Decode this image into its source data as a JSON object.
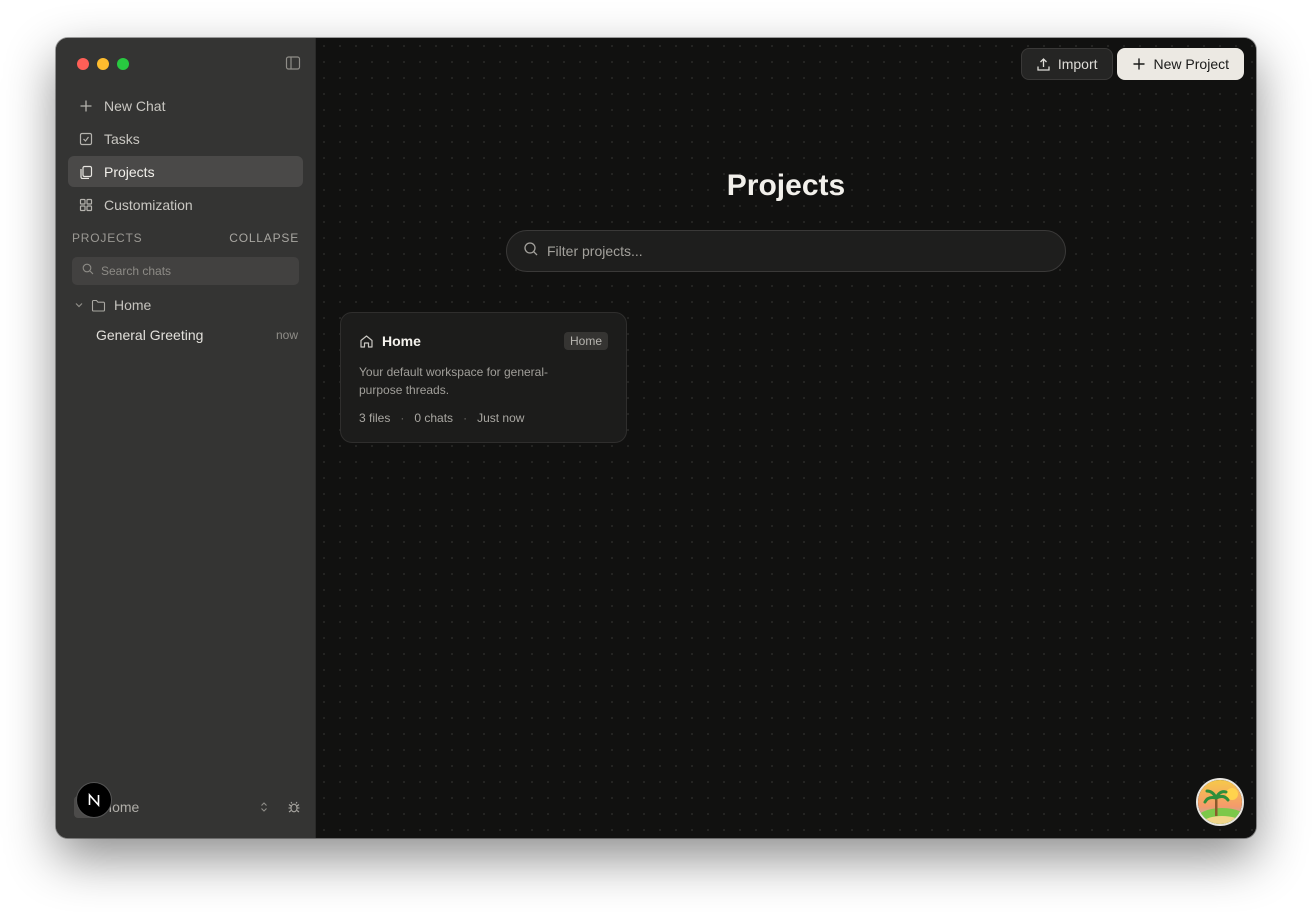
{
  "sidebar": {
    "nav": [
      {
        "label": "New Chat",
        "icon": "plus-icon"
      },
      {
        "label": "Tasks",
        "icon": "checkbox-icon"
      },
      {
        "label": "Projects",
        "icon": "files-icon",
        "active": true
      },
      {
        "label": "Customization",
        "icon": "grid-icon"
      }
    ],
    "section_label": "PROJECTS",
    "collapse_label": "COLLAPSE",
    "search_placeholder": "Search chats",
    "folder": {
      "name": "Home"
    },
    "chats": [
      {
        "title": "General Greeting",
        "time": "now"
      }
    ],
    "workspace_name": "Home"
  },
  "header": {
    "import_label": "Import",
    "new_project_label": "New Project"
  },
  "main": {
    "title": "Projects",
    "filter_placeholder": "Filter projects...",
    "projects": [
      {
        "name": "Home",
        "tag": "Home",
        "description": "Your default workspace for general-purpose threads.",
        "files": "3 files",
        "chats": "0 chats",
        "updated": "Just now"
      }
    ]
  },
  "colors": {
    "accent_button": "#ece9e3",
    "sidebar_bg": "#343433",
    "main_bg": "#111110"
  }
}
